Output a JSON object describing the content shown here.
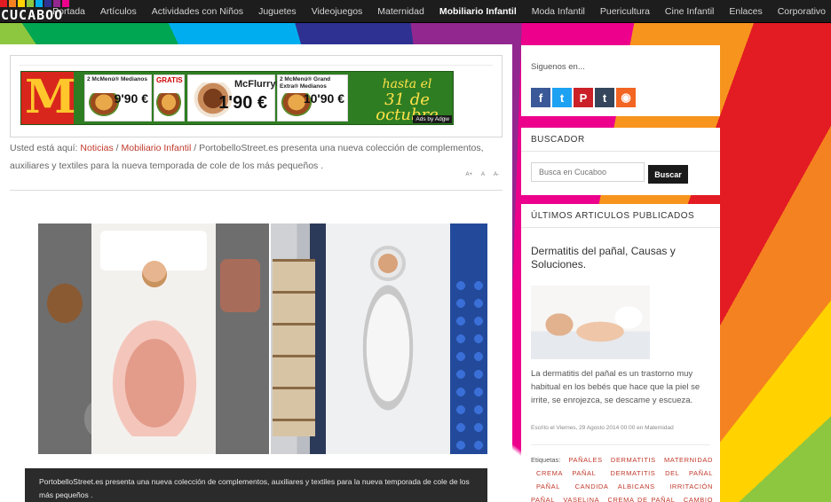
{
  "brand": {
    "logo_text": "CUCABOO",
    "block_colors": [
      "#e31b23",
      "#f58220",
      "#ffd200",
      "#8dc63f",
      "#00aeef",
      "#2e3192",
      "#92278f",
      "#ec008c"
    ]
  },
  "nav": {
    "items": [
      "Portada",
      "Artículos",
      "Actividades con Niños",
      "Juguetes",
      "Videojuegos",
      "Maternidad",
      "Mobiliario Infantil",
      "Moda Infantil",
      "Puericultura",
      "Cine Infantil",
      "Enlaces",
      "Corporativo"
    ],
    "active": "Mobiliario Infantil"
  },
  "ad": {
    "brand_letter": "M",
    "offers": [
      {
        "title": "2 McMenú® Medianos",
        "price": "9'90 €"
      },
      {
        "title": "GRATIS",
        "price": "Gratis"
      },
      {
        "title": "McFlurry®",
        "price": "1'90 €"
      },
      {
        "title": "2 McMenú® Grand Extra® Medianos",
        "price": "10'90 €"
      }
    ],
    "hasta_line1": "hasta el",
    "hasta_line2": "31 de octubre",
    "ads_by": "Ads by Adgw"
  },
  "breadcrumb": {
    "prefix": "Usted está aquí: ",
    "link1": "Noticias",
    "sep": " / ",
    "link2": "Mobiliario Infantil",
    "current": "PortobelloStreet.es presenta una nueva colección de complementos, auxiliares y textiles para la nueva temporada de cole de los más pequeños ."
  },
  "font_controls": [
    "A+",
    "A",
    "A-"
  ],
  "caption": "PortobelloStreet.es presenta una nueva colección de complementos, auxiliares y textiles para la nueva temporada de cole de los más pequeños .",
  "sidebar": {
    "follow_label": "Siguenos en...",
    "social": [
      {
        "icon": "facebook-icon",
        "glyph": "f",
        "color": "#3b5998"
      },
      {
        "icon": "twitter-icon",
        "glyph": "t",
        "color": "#1da1f2"
      },
      {
        "icon": "pinterest-icon",
        "glyph": "P",
        "color": "#cb2027"
      },
      {
        "icon": "tumblr-icon",
        "glyph": "t",
        "color": "#35465c"
      },
      {
        "icon": "rss-icon",
        "glyph": "◉",
        "color": "#f26522"
      }
    ],
    "search_title": "BUSCADOR",
    "search_placeholder": "Busca en Cucaboo",
    "search_button": "Buscar",
    "latest_title": "ÚLTIMOS ARTICULOS PUBLICADOS",
    "article_title": "Dermatitis del pañal, Causas y Soluciones.",
    "article_excerpt": "La dermatitis del pañal es un trastorno muy habitual en los bebés que hace que la piel se irrite, se enrojezca, se descame y escueza.",
    "article_meta": "Escrito el Viernes, 29 Agosto 2014 00:00 en Maternidad",
    "tags_label": "Etiquetas:",
    "tags": [
      "pañales",
      "dermatitis",
      "maternidad",
      "crema pañal",
      "dermatitis del pañal",
      "pañal",
      "candida albicans",
      "irritación pañal",
      "vaselina",
      "crema de pañal",
      "cambio de pañal"
    ]
  }
}
